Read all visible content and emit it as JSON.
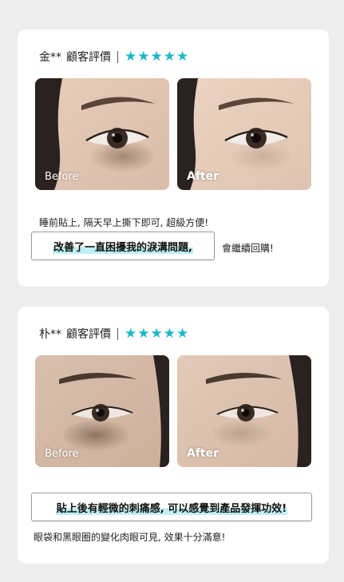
{
  "reviews": [
    {
      "reviewer": "金**",
      "review_label": "顧客評價",
      "stars": 5,
      "star_color": "#19b8c5",
      "before_label": "Before",
      "after_label": "After",
      "text_line": "睡前貼上, 隔天早上撕下即可, 超級方便!",
      "highlight": "改善了一直困擾我的淚溝問題,",
      "tail_text": "會繼續回購!"
    },
    {
      "reviewer": "朴**",
      "review_label": "顧客評價",
      "stars": 5,
      "star_color": "#19b8c5",
      "before_label": "Before",
      "after_label": "After",
      "highlight": "貼上後有輕微的刺痛感, 可以感覺到產品發揮功效!",
      "text_line": "眼袋和黑眼圈的變化肉眼可見, 效果十分滿意!"
    }
  ],
  "icons": {
    "star": "★"
  },
  "colors": {
    "background": "#ededed",
    "card": "#ffffff",
    "accent": "#19b8c5",
    "highlight": "#bfeff2"
  }
}
